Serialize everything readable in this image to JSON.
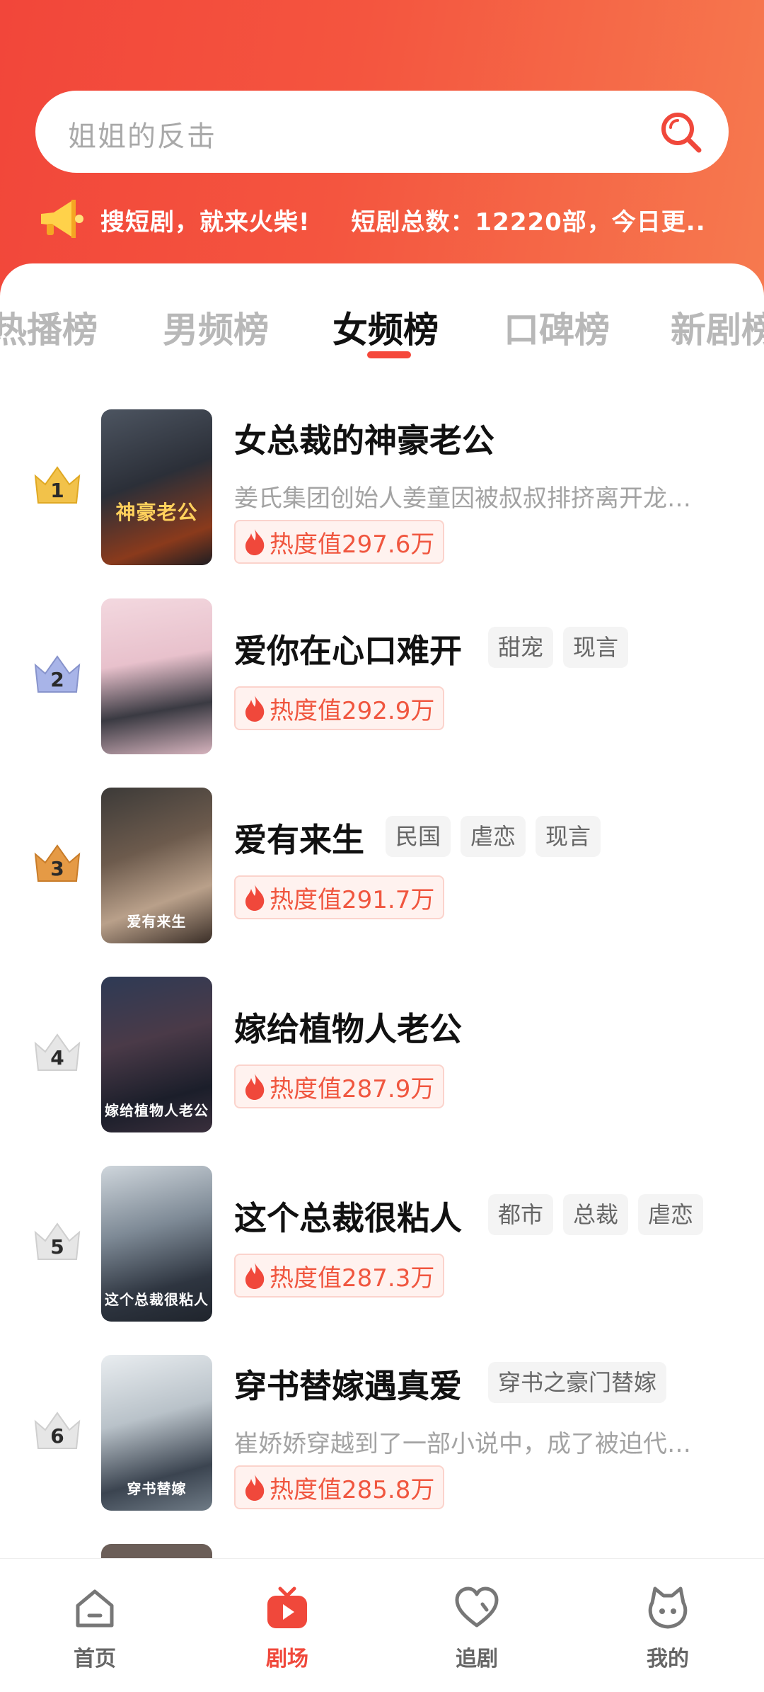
{
  "search": {
    "placeholder": "姐姐的反击"
  },
  "notice": {
    "part1": "搜短剧，就来火柴!",
    "part2": "短剧总数：12220部，今日更.."
  },
  "tabs": [
    "热播榜",
    "男频榜",
    "女频榜",
    "口碑榜",
    "新剧榜"
  ],
  "active_tab": "女频榜",
  "items": [
    {
      "rank": "1",
      "title": "女总裁的神豪老公",
      "tags": [],
      "desc": "姜氏集团创始人姜童因被叔叔排挤离开龙…",
      "heat": "热度值297.6万",
      "cover_text": "神豪老公"
    },
    {
      "rank": "2",
      "title": "爱你在心口难开",
      "tags": [
        "甜宠",
        "现言"
      ],
      "desc": "",
      "heat": "热度值292.9万",
      "cover_text": ""
    },
    {
      "rank": "3",
      "title": "爱有来生",
      "tags": [
        "民国",
        "虐恋",
        "现言"
      ],
      "desc": "",
      "heat": "热度值291.7万",
      "cover_text": "爱有来生"
    },
    {
      "rank": "4",
      "title": "嫁给植物人老公",
      "tags": [],
      "desc": "",
      "heat": "热度值287.9万",
      "cover_text": "嫁给植物人老公"
    },
    {
      "rank": "5",
      "title": "这个总裁很粘人",
      "tags": [
        "都市",
        "总裁",
        "虐恋"
      ],
      "desc": "",
      "heat": "热度值287.3万",
      "cover_text": "这个总裁很粘人"
    },
    {
      "rank": "6",
      "title": "穿书替嫁遇真爱",
      "tags": [
        "穿书之豪门替嫁"
      ],
      "desc": "崔娇娇穿越到了一部小说中，成了被迫代…",
      "heat": "热度值285.8万",
      "cover_text": "穿书替嫁"
    }
  ],
  "nav": {
    "home": "首页",
    "theater": "剧场",
    "follow": "追剧",
    "mine": "我的"
  },
  "colors": {
    "accent": "#f0483b",
    "gold": "#f2c24a",
    "silver": "#a8b4e8",
    "bronze": "#e59a45",
    "white_crown": "#d9d9d9"
  }
}
